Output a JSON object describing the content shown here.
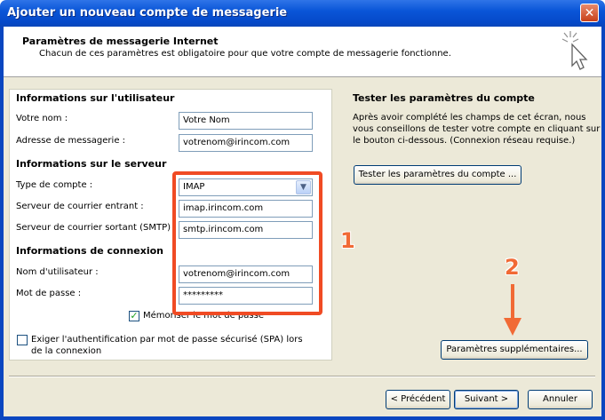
{
  "window": {
    "title": "Ajouter un nouveau compte de messagerie",
    "close_glyph": "✕"
  },
  "header": {
    "title": "Paramètres de messagerie Internet",
    "subtitle": "Chacun de ces paramètres est obligatoire pour que votre compte de messagerie fonctionne."
  },
  "user_info": {
    "title": "Informations sur l'utilisateur",
    "name_label": "Votre nom :",
    "name_value": "Votre Nom",
    "email_label": "Adresse de messagerie :",
    "email_value": "votrenom@irincom.com"
  },
  "server_info": {
    "title": "Informations sur le serveur",
    "type_label": "Type de compte :",
    "type_value": "IMAP",
    "incoming_label": "Serveur de courrier entrant :",
    "incoming_value": "imap.irincom.com",
    "outgoing_label": "Serveur de courrier sortant (SMTP)",
    "outgoing_value": "smtp.irincom.com"
  },
  "login_info": {
    "title": "Informations de connexion",
    "user_label": "Nom d'utilisateur :",
    "user_value": "votrenom@irincom.com",
    "password_label": "Mot de passe :",
    "password_value": "*********",
    "remember_label": "Mémoriser le mot de passe",
    "remember_checked": true,
    "spa_label_line1": "Exiger l'authentification par mot de passe sécurisé (SPA) lors",
    "spa_label_line2": "de la connexion",
    "spa_checked": false
  },
  "test": {
    "title": "Tester les paramètres du compte",
    "desc_line1": "Après avoir complété les champs de cet écran, nous",
    "desc_line2": "vous conseillons de tester votre compte en cliquant sur",
    "desc_line3": "le bouton ci-dessous. (Connexion réseau requise.)",
    "button_label": "Tester les paramètres du compte ..."
  },
  "more_settings_label": "Paramètres supplémentaires...",
  "nav": {
    "back_label": "< Précédent",
    "next_label": "Suivant >",
    "cancel_label": "Annuler"
  },
  "annotations": {
    "one": "1",
    "two": "2",
    "color": "#f04b24"
  },
  "icons": {
    "header_icon": "cursor-sparkle-icon",
    "dropdown": "chevron-down-icon"
  }
}
